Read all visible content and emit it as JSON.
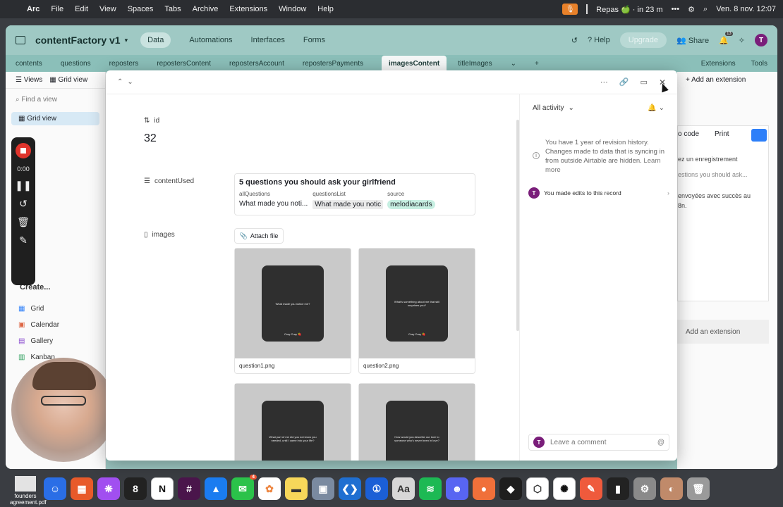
{
  "menubar": {
    "app": "Arc",
    "items": [
      "File",
      "Edit",
      "View",
      "Spaces",
      "Tabs",
      "Archive",
      "Extensions",
      "Window",
      "Help"
    ],
    "event": "Repas 🍏 · in 23 m",
    "datetime": "Ven. 8 nov.  12:07"
  },
  "topbar": {
    "base_name": "contentFactory v1",
    "nav": [
      "Data",
      "Automations",
      "Interfaces",
      "Forms"
    ],
    "help": "Help",
    "upgrade": "Upgrade",
    "share": "Share",
    "notif_count": "13",
    "avatar": "T"
  },
  "tables": {
    "items": [
      "contents",
      "questions",
      "reposters",
      "repostersContent",
      "repostersAccount",
      "repostersPayments",
      "imagesContent",
      "titleImages"
    ],
    "extensions": "Extensions",
    "tools": "Tools"
  },
  "sidebar": {
    "views_label": "Views",
    "grid_view_tab": "Grid view",
    "find_placeholder": "Find a view",
    "active_view": "Grid view",
    "create_label": "Create...",
    "create_items": [
      "Grid",
      "Calendar",
      "Gallery",
      "Kanban"
    ]
  },
  "behind_right": {
    "add_extension": "Add an extension",
    "code_btn": "o code",
    "print_btn": "Print",
    "text1": "ez un enregistrement",
    "text2": "estions you should ask...",
    "text3": "envoyées avec succès au",
    "text4": "8n.",
    "add_extension2": "Add an extension"
  },
  "recorder": {
    "time": "0:00"
  },
  "record": {
    "id_label": "id",
    "id_value": "32",
    "content_used_label": "contentUsed",
    "linked_title": "5 questions you should ask your girlfriend",
    "linked_cols": [
      {
        "header": "allQuestions",
        "value": "What made you noti..."
      },
      {
        "header": "questionsList",
        "value": "What made you notic"
      },
      {
        "header": "source",
        "value": "melodiacards"
      }
    ],
    "images_label": "images",
    "attach_label": "Attach file",
    "images": [
      {
        "text": "What made you notice me?",
        "brand": "Cray Cray 🍓",
        "file": "question1.png"
      },
      {
        "text": "What's something about me that still surprises you?",
        "brand": "Cray Cray 🍓",
        "file": "question2.png"
      },
      {
        "text": "What part of me did you not know you needed, until I came into your life?",
        "brand": "",
        "file": ""
      },
      {
        "text": "How would you describe our love to someone who's never been in love?",
        "brand": "",
        "file": ""
      }
    ]
  },
  "activity": {
    "filter": "All activity",
    "revision_text": "You have 1 year of revision history. Changes made to data that is syncing in from outside Airtable are hidden.",
    "learn_more": "Learn more",
    "edit_text": "You made edits to this record",
    "comment_placeholder": "Leave a comment",
    "avatar": "T"
  },
  "dock": {
    "desk_file": "founders agreement.pdf",
    "mail_badge": "4"
  },
  "colors": {
    "accent_teal": "#9bc5c0",
    "tag_green": "#c7efe2",
    "avatar_purple": "#7a1e7a",
    "record_red": "#e0342c"
  }
}
